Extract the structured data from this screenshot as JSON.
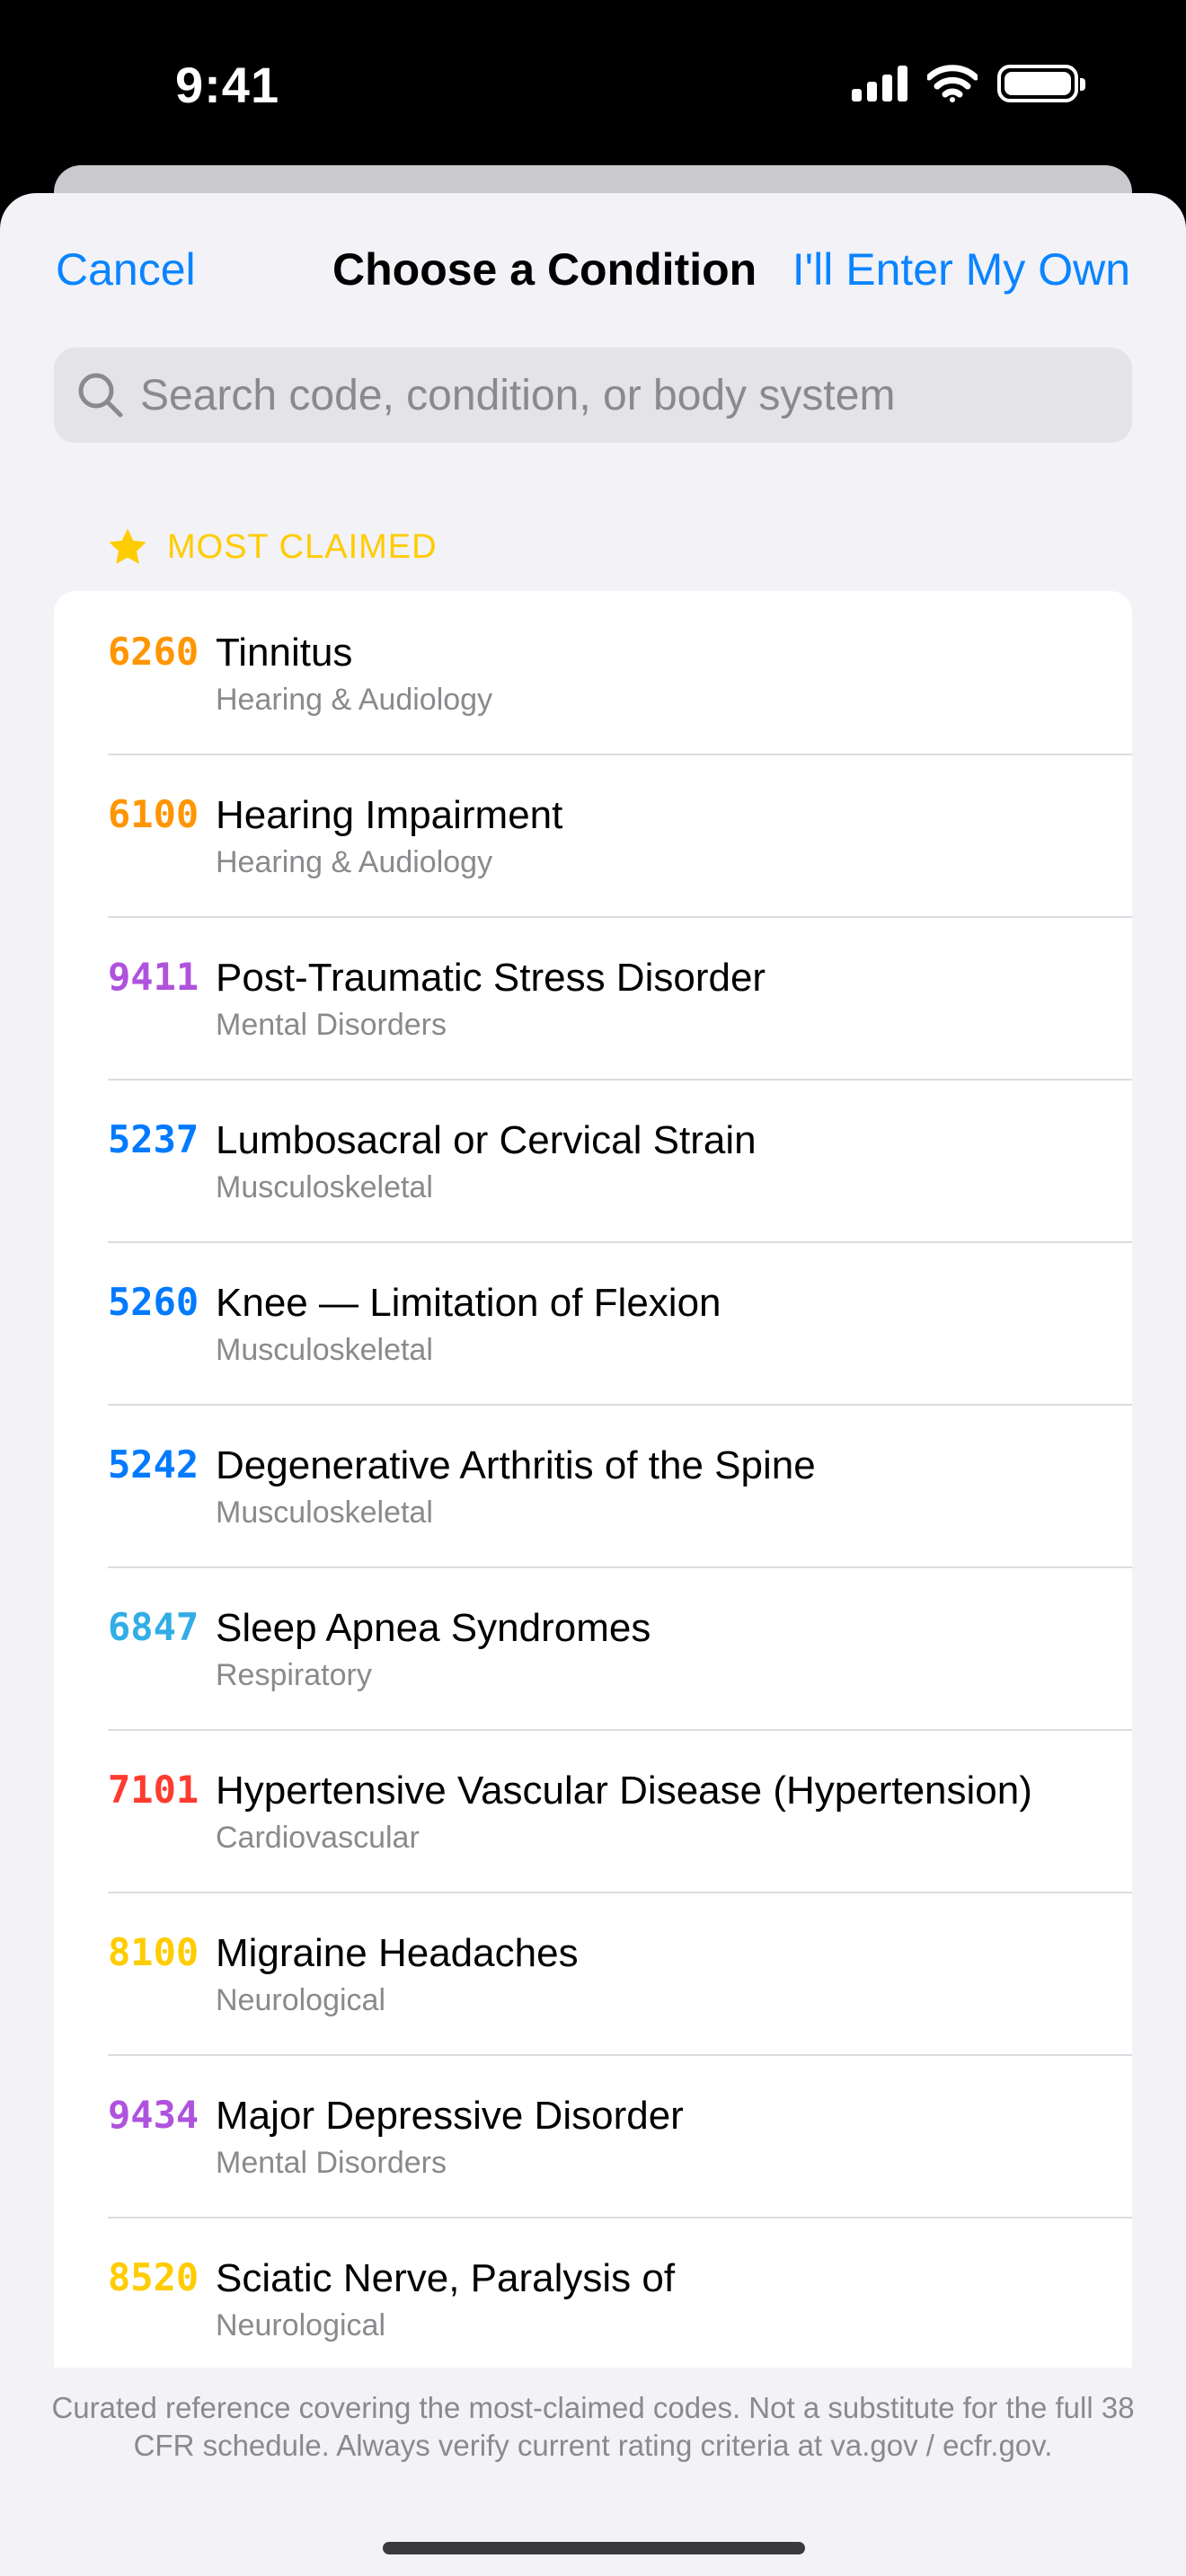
{
  "status_bar": {
    "time": "9:41"
  },
  "nav": {
    "cancel_label": "Cancel",
    "title": "Choose a Condition",
    "enter_own_label": "I'll Enter My Own"
  },
  "search": {
    "placeholder": "Search code, condition, or body system"
  },
  "section": {
    "title": "MOST CLAIMED",
    "icon": "star-icon",
    "icon_color": "#FFCC00"
  },
  "conditions": [
    {
      "code": "6260",
      "name": "Tinnitus",
      "system": "Hearing & Audiology",
      "color": "#FF9500"
    },
    {
      "code": "6100",
      "name": "Hearing Impairment",
      "system": "Hearing & Audiology",
      "color": "#FF9500"
    },
    {
      "code": "9411",
      "name": "Post-Traumatic Stress Disorder",
      "system": "Mental Disorders",
      "color": "#AF52DE"
    },
    {
      "code": "5237",
      "name": "Lumbosacral or Cervical Strain",
      "system": "Musculoskeletal",
      "color": "#007AFF"
    },
    {
      "code": "5260",
      "name": "Knee — Limitation of Flexion",
      "system": "Musculoskeletal",
      "color": "#007AFF"
    },
    {
      "code": "5242",
      "name": "Degenerative Arthritis of the Spine",
      "system": "Musculoskeletal",
      "color": "#007AFF"
    },
    {
      "code": "6847",
      "name": "Sleep Apnea Syndromes",
      "system": "Respiratory",
      "color": "#32ADE6"
    },
    {
      "code": "7101",
      "name": "Hypertensive Vascular Disease (Hypertension)",
      "system": "Cardiovascular",
      "color": "#FF3B30"
    },
    {
      "code": "8100",
      "name": "Migraine Headaches",
      "system": "Neurological",
      "color": "#FFCC00"
    },
    {
      "code": "9434",
      "name": "Major Depressive Disorder",
      "system": "Mental Disorders",
      "color": "#AF52DE"
    },
    {
      "code": "8520",
      "name": "Sciatic Nerve, Paralysis of",
      "system": "Neurological",
      "color": "#FFCC00"
    }
  ],
  "footer": {
    "note": "Curated reference covering the most-claimed codes. Not a substitute for the full 38 CFR schedule. Always verify current rating criteria at va.gov / ecfr.gov."
  }
}
